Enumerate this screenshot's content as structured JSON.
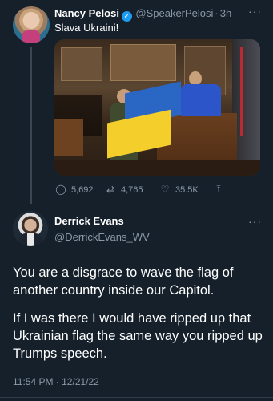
{
  "tweet1": {
    "name": "Nancy Pelosi",
    "handle": "@SpeakerPelosi",
    "separator": "·",
    "time": "3h",
    "text": "Slava Ukraini!",
    "stats": {
      "replies": "5,692",
      "retweets": "4,765",
      "likes": "35.5K"
    }
  },
  "tweet2": {
    "name": "Derrick Evans",
    "handle": "@DerrickEvans_WV",
    "paragraph1": "You are a disgrace to wave the flag of another country inside our Capitol.",
    "paragraph2": "If I was there I would have ripped up that Ukrainian flag the same way you ripped up Trumps speech.",
    "timestamp": "11:54 PM · 12/21/22"
  },
  "icons": [
    "verified-badge-icon",
    "more-icon",
    "reply-icon",
    "retweet-icon",
    "like-icon",
    "share-icon"
  ],
  "colors": {
    "background": "#15202b",
    "text_primary": "#ffffff",
    "text_secondary": "#8b98a5",
    "accent": "#1d9bf0"
  }
}
